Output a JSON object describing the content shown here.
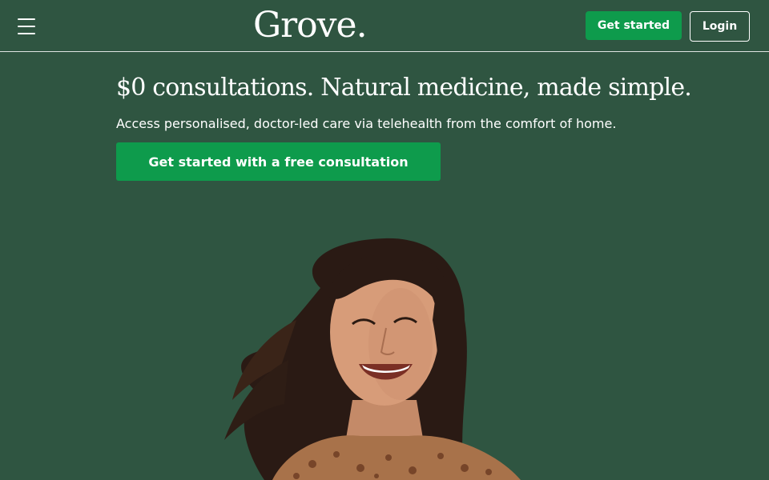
{
  "header": {
    "brand": "Grove.",
    "get_started_label": "Get started",
    "login_label": "Login",
    "menu_icon": "hamburger-menu-icon"
  },
  "hero": {
    "title": "$0 consultations. Natural medicine, made simple.",
    "subtitle": "Access personalised, doctor-led care via telehealth from the comfort of home.",
    "cta_label": "Get started with a free consultation",
    "image": "smiling-woman-photo"
  },
  "colors": {
    "background": "#2f5541",
    "accent_green": "#0e9b4c",
    "text": "#ffffff"
  }
}
